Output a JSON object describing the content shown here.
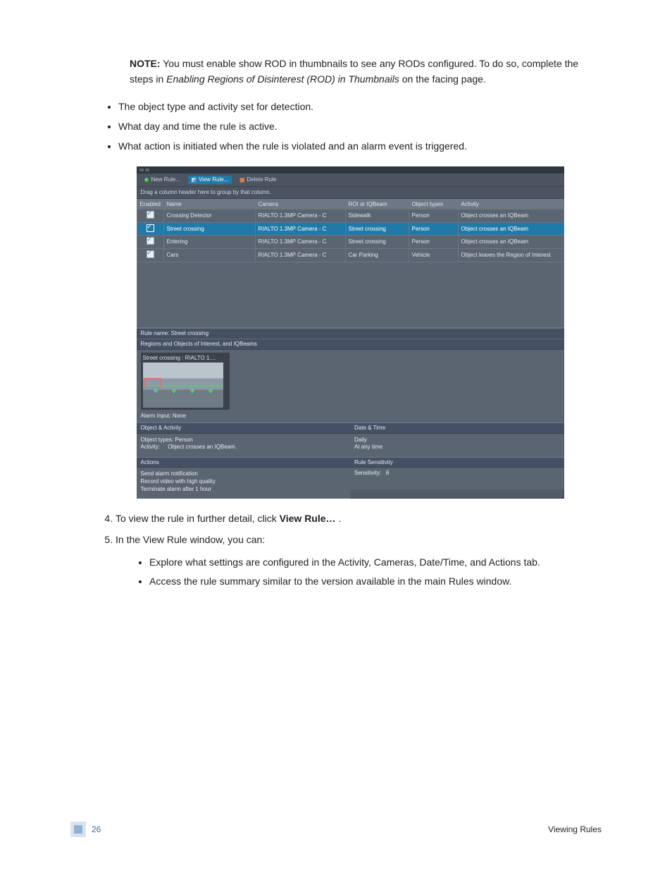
{
  "note": {
    "label": "NOTE:",
    "text_a": "You must enable show ROD in thumbnails to see any RODs configured. To do so, complete the steps in ",
    "em": "Enabling Regions of Disinterest (ROD) in Thumbnails",
    "text_b": " on the facing page."
  },
  "bullets_top": [
    "The object type and activity set for detection.",
    "What day and time the rule is active.",
    "What action is initiated when the rule is violated and an alarm event is triggered."
  ],
  "step4_a": "To view the rule in further detail, click ",
  "step4_b": "View Rule…",
  "step4_c": ".",
  "step5": "In the View Rule window, you can:",
  "bullets_sub": [
    "Explore what settings are configured in the Activity, Cameras, Date/Time, and Actions tab.",
    "Access the rule summary similar to the version available in the main Rules window."
  ],
  "app": {
    "toolbar": {
      "new": "New Rule...",
      "view": "View Rule...",
      "delete": "Delete Rule"
    },
    "group_hint": "Drag a column header here to group by that column.",
    "columns": {
      "enabled": "Enabled",
      "name": "Name",
      "camera": "Camera",
      "roi": "ROI or IQBeam",
      "types": "Object types",
      "activity": "Activity"
    },
    "rows": [
      {
        "name": "Crossing Detector",
        "camera": "RIALTO 1.3MP Camera - C",
        "roi": "Sidewalk",
        "types": "Person",
        "activity": "Object crosses an IQBeam",
        "sel": false
      },
      {
        "name": "Street crossing",
        "camera": "RIALTO 1.3MP Camera - C",
        "roi": "Street crossing",
        "types": "Person",
        "activity": "Object crosses an IQBeam",
        "sel": true
      },
      {
        "name": "Entering",
        "camera": "RIALTO 1.3MP Camera - C",
        "roi": "Street crossing",
        "types": "Person",
        "activity": "Object crosses an IQBeam",
        "sel": false
      },
      {
        "name": "Cars",
        "camera": "RIALTO 1.3MP Camera - C",
        "roi": "Car Parking",
        "types": "Vehicle",
        "activity": "Object leaves the Region of Interest",
        "sel": false
      }
    ],
    "rule_name_label": "Rule name:",
    "rule_name_value": "Street crossing",
    "roi_section": "Regions and Objects of Interest, and IQBeams",
    "thumb_title": "Street crossing : RIALTO 1....",
    "alarm_input_label": "Alarm Input:",
    "alarm_input_value": "None",
    "object_activity_head": "Object & Activity",
    "object_types_label": "Object types:",
    "object_types_value": "Person",
    "activity_label": "Activity:",
    "activity_value": "Object crosses an IQBeam.",
    "date_time_head": "Date & Time",
    "date_time_l1": "Daily",
    "date_time_l2": "At any time",
    "actions_head": "Actions",
    "actions_l1": "Send alarm notification",
    "actions_l2": "Record video with high quality",
    "actions_l3": "Terminate alarm after 1 hour",
    "sensitivity_head": "Rule Sensitivity",
    "sensitivity_label": "Sensitivity:",
    "sensitivity_value": "8"
  },
  "footer": {
    "page": "26",
    "section": "Viewing Rules"
  }
}
